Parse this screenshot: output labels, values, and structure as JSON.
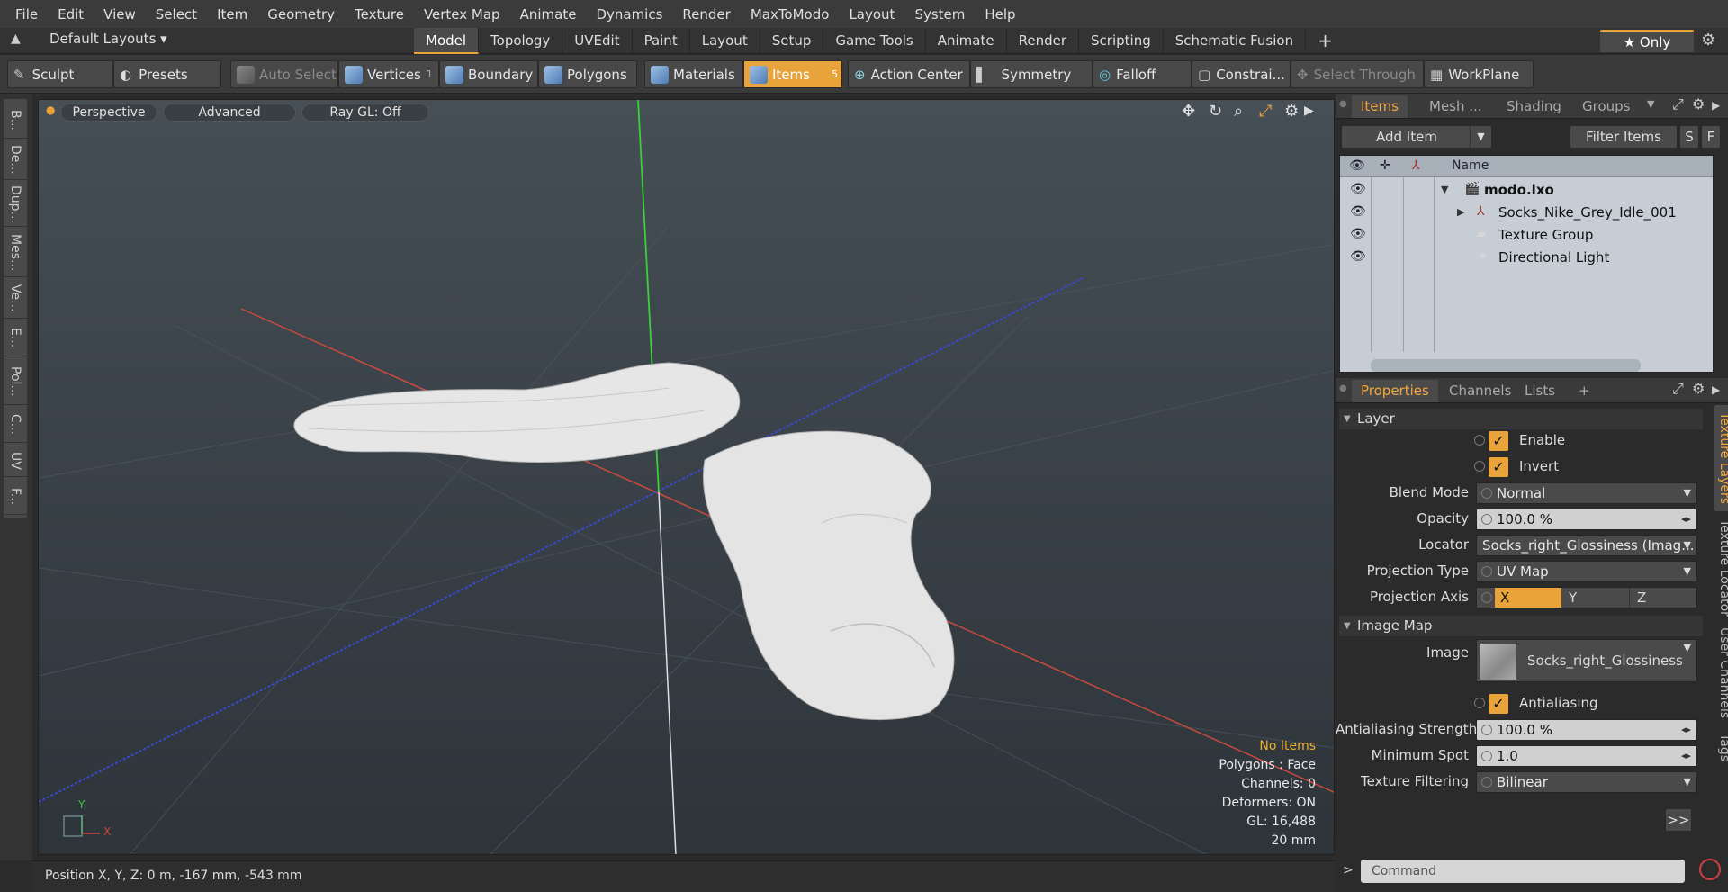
{
  "menu": [
    "File",
    "Edit",
    "View",
    "Select",
    "Item",
    "Geometry",
    "Texture",
    "Vertex Map",
    "Animate",
    "Dynamics",
    "Render",
    "MaxToModo",
    "Layout",
    "System",
    "Help"
  ],
  "layout_selector": "Default Layouts ▾",
  "layout_tabs": [
    "Model",
    "Topology",
    "UVEdit",
    "Paint",
    "Layout",
    "Setup",
    "Game Tools",
    "Animate",
    "Render",
    "Scripting",
    "Schematic Fusion"
  ],
  "add_tab": "+",
  "only_button": "★  Only",
  "toolbar": {
    "sculpt": "Sculpt",
    "presets": "Presets",
    "auto_select": "Auto Select",
    "vertices": "Vertices",
    "vertices_count": "1",
    "boundary": "Boundary",
    "polygons": "Polygons",
    "materials": "Materials",
    "items": "Items",
    "items_count": "5",
    "action_center": "Action Center",
    "symmetry": "Symmetry",
    "falloff": "Falloff",
    "constraints": "Constrai...",
    "select_through": "Select Through",
    "workplane": "WorkPlane"
  },
  "left_tabs": [
    "B...",
    "De...",
    "Dup...",
    "Mes...",
    "Ve...",
    "E...",
    "Pol...",
    "C...",
    "UV",
    "F..."
  ],
  "viewport": {
    "perspective": "Perspective",
    "advanced": "Advanced",
    "raygl": "Ray GL: Off",
    "info": {
      "no_items": "No Items",
      "polygons": "Polygons : Face",
      "channels": "Channels: 0",
      "deformers": "Deformers: ON",
      "gl": "GL: 16,488",
      "scale": "20 mm"
    },
    "axis_y": "Y",
    "axis_x": "X"
  },
  "status": "Position X, Y, Z:   0 m, -167 mm, -543 mm",
  "items_panel": {
    "tabs": [
      "Items",
      "Mesh ...",
      "Shading",
      "Groups"
    ],
    "add_item": "Add Item",
    "filter_items": "Filter Items",
    "filter_s": "S",
    "filter_f": "F",
    "col_name": "Name",
    "rows": [
      {
        "label": "modo.lxo",
        "indent": 0
      },
      {
        "label": "Socks_Nike_Grey_Idle_001",
        "indent": 1
      },
      {
        "label": "Texture Group",
        "indent": 1
      },
      {
        "label": "Directional Light",
        "indent": 1
      }
    ]
  },
  "props_panel": {
    "tabs": [
      "Properties",
      "Channels",
      "Lists"
    ],
    "add": "+",
    "layer": "Layer",
    "enable": "Enable",
    "invert": "Invert",
    "blend_mode_label": "Blend Mode",
    "blend_mode": "Normal",
    "opacity_label": "Opacity",
    "opacity": "100.0 %",
    "locator_label": "Locator",
    "locator": "Socks_right_Glossiness (Imag...",
    "projection_type_label": "Projection Type",
    "projection_type": "UV Map",
    "projection_axis_label": "Projection Axis",
    "axis_x": "X",
    "axis_y": "Y",
    "axis_z": "Z",
    "image_map": "Image Map",
    "image_label": "Image",
    "image": "Socks_right_Glossiness",
    "antialiasing": "Antialiasing",
    "aa_strength_label": "Antialiasing Strength",
    "aa_strength": "100.0 %",
    "min_spot_label": "Minimum Spot",
    "min_spot": "1.0",
    "tex_filter_label": "Texture Filtering",
    "tex_filter": "Bilinear",
    "more": ">>"
  },
  "right_tabs": [
    "Texture Layers",
    "Texture Locator",
    "User Channels",
    "Tags"
  ],
  "command_placeholder": "Command",
  "colors": {
    "accent": "#e8a33a",
    "axis_x": "#d0443a",
    "axis_y": "#3ac93a",
    "axis_z": "#3a4ad0"
  }
}
